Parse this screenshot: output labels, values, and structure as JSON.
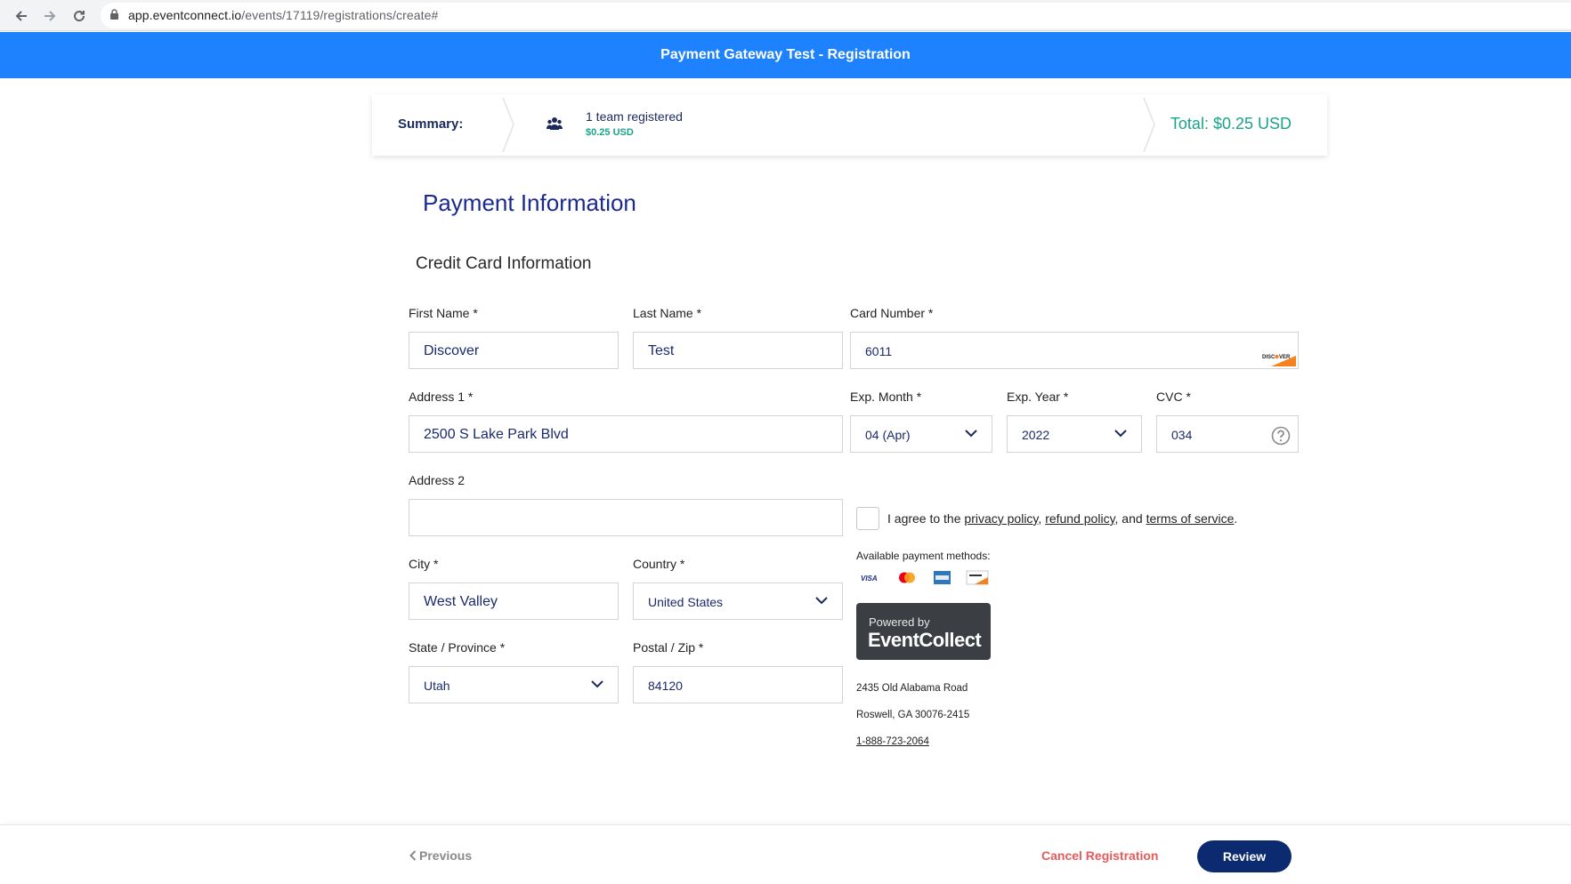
{
  "browser": {
    "url_host": "app.eventconnect.io",
    "url_path": "/events/17119/registrations/create#"
  },
  "header": {
    "title": "Payment Gateway Test - Registration"
  },
  "summary": {
    "label": "Summary:",
    "team_title": "1 team registered",
    "team_price": "$0.25 USD",
    "total": "Total: $0.25 USD"
  },
  "payment": {
    "heading": "Payment Information",
    "subheading": "Credit Card Information"
  },
  "form": {
    "first_name": {
      "label": "First Name *",
      "value": "Discover"
    },
    "last_name": {
      "label": "Last Name *",
      "value": "Test"
    },
    "card_number": {
      "label": "Card Number *",
      "value": "6011"
    },
    "address1": {
      "label": "Address 1 *",
      "value": "2500 S Lake Park Blvd"
    },
    "exp_month": {
      "label": "Exp. Month *",
      "value": "04 (Apr)"
    },
    "exp_year": {
      "label": "Exp. Year *",
      "value": "2022"
    },
    "cvc": {
      "label": "CVC *",
      "value": "034"
    },
    "address2": {
      "label": "Address 2",
      "value": ""
    },
    "city": {
      "label": "City *",
      "value": "West Valley"
    },
    "country": {
      "label": "Country *",
      "value": "United States"
    },
    "state": {
      "label": "State / Province *",
      "value": "Utah"
    },
    "postal": {
      "label": "Postal / Zip *",
      "value": "84120"
    }
  },
  "agreement": {
    "prefix": "I agree to the ",
    "privacy": "privacy policy",
    "comma1": ", ",
    "refund": "refund policy",
    "and": ", and ",
    "terms": "terms of service",
    "suffix": "."
  },
  "payment_methods": {
    "label": "Available payment methods:",
    "icons": [
      "visa-icon",
      "mastercard-icon",
      "amex-icon",
      "discover-icon"
    ]
  },
  "powered_by": {
    "line1": "Powered by",
    "line2": "EventCollect"
  },
  "company": {
    "address1": "2435 Old Alabama Road",
    "address2": "Roswell, GA 30076-2415",
    "phone": "1-888-723-2064"
  },
  "footer": {
    "previous": "Previous",
    "cancel": "Cancel Registration",
    "review": "Review"
  },
  "colors": {
    "header_blue": "#1e82ff",
    "navy": "#0b2a6f",
    "teal": "#1aa38a",
    "cancel_red": "#e85a5a"
  }
}
